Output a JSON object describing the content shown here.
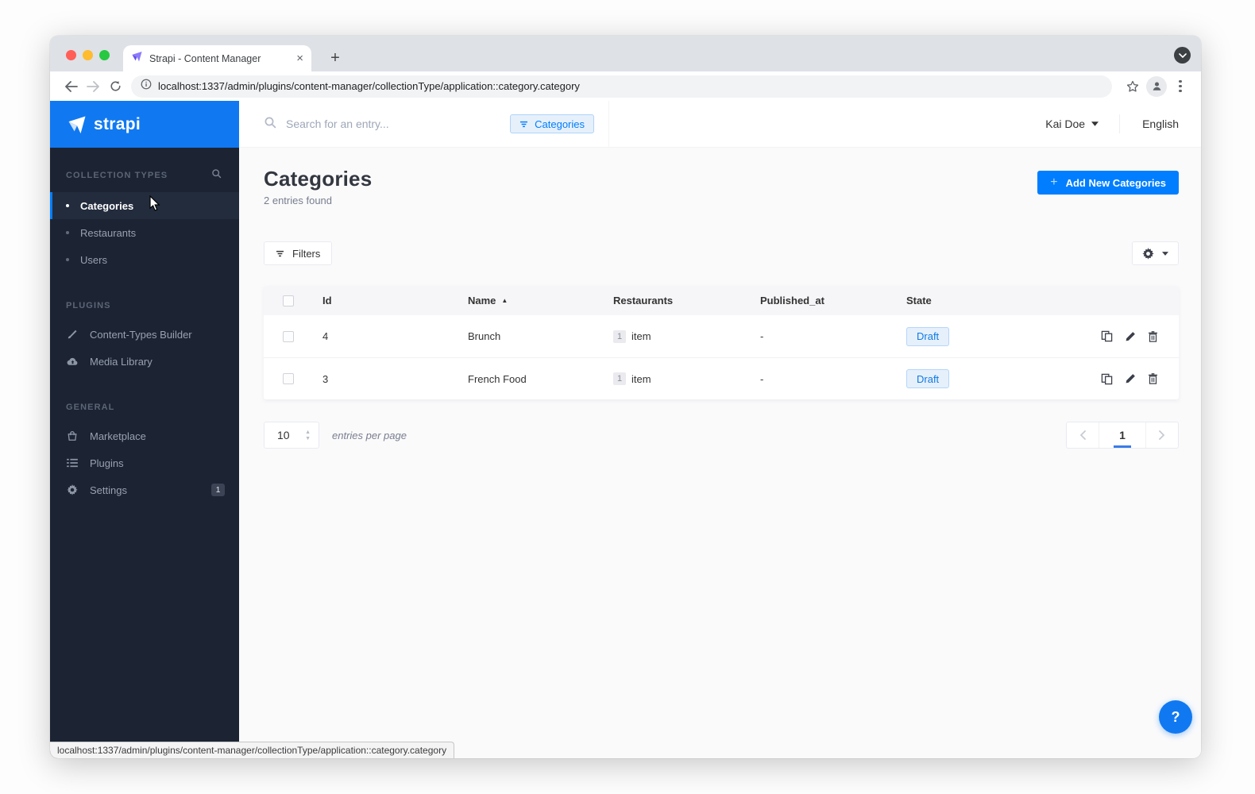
{
  "browser": {
    "tab_title": "Strapi - Content Manager",
    "url": "localhost:1337/admin/plugins/content-manager/collectionType/application::category.category",
    "status_url": "localhost:1337/admin/plugins/content-manager/collectionType/application::category.category",
    "close_glyph": "×",
    "newtab_glyph": "+"
  },
  "sidebar": {
    "logo": "strapi",
    "collection_types": {
      "label": "COLLECTION TYPES",
      "items": [
        {
          "label": "Categories"
        },
        {
          "label": "Restaurants"
        },
        {
          "label": "Users"
        }
      ],
      "active": "Categories"
    },
    "plugins_section": {
      "label": "PLUGINS",
      "items": [
        {
          "label": "Content-Types Builder"
        },
        {
          "label": "Media Library"
        }
      ]
    },
    "general_section": {
      "label": "GENERAL",
      "items": [
        {
          "label": "Marketplace"
        },
        {
          "label": "Plugins"
        },
        {
          "label": "Settings",
          "badge": "1"
        }
      ]
    }
  },
  "topbar": {
    "search_placeholder": "Search for an entry...",
    "filter_chip": "Categories",
    "user": "Kai Doe",
    "language": "English"
  },
  "page": {
    "title": "Categories",
    "subtitle": "2 entries found",
    "add_button": "Add New Categories",
    "add_plus": "+",
    "filters_button": "Filters"
  },
  "table": {
    "headers": {
      "id": "Id",
      "name": "Name",
      "restaurants": "Restaurants",
      "published_at": "Published_at",
      "state": "State"
    },
    "sort_indicator": "▲",
    "sorted_by": "Name",
    "rows": [
      {
        "id": "4",
        "name": "Brunch",
        "count": "1",
        "count_label": "item",
        "published_at": "-",
        "state": "Draft"
      },
      {
        "id": "3",
        "name": "French Food",
        "count": "1",
        "count_label": "item",
        "published_at": "-",
        "state": "Draft"
      }
    ]
  },
  "pagination": {
    "page_size": "10",
    "per_page_label": "entries per page",
    "current_page": "1"
  },
  "help": {
    "label": "?"
  },
  "colors": {
    "accent_blue": "#007eff",
    "header_blue": "#1079f1",
    "sidebar_dark": "#1c2433",
    "draft_bg": "#e6f0fb",
    "draft_text": "#0f7ae5"
  }
}
